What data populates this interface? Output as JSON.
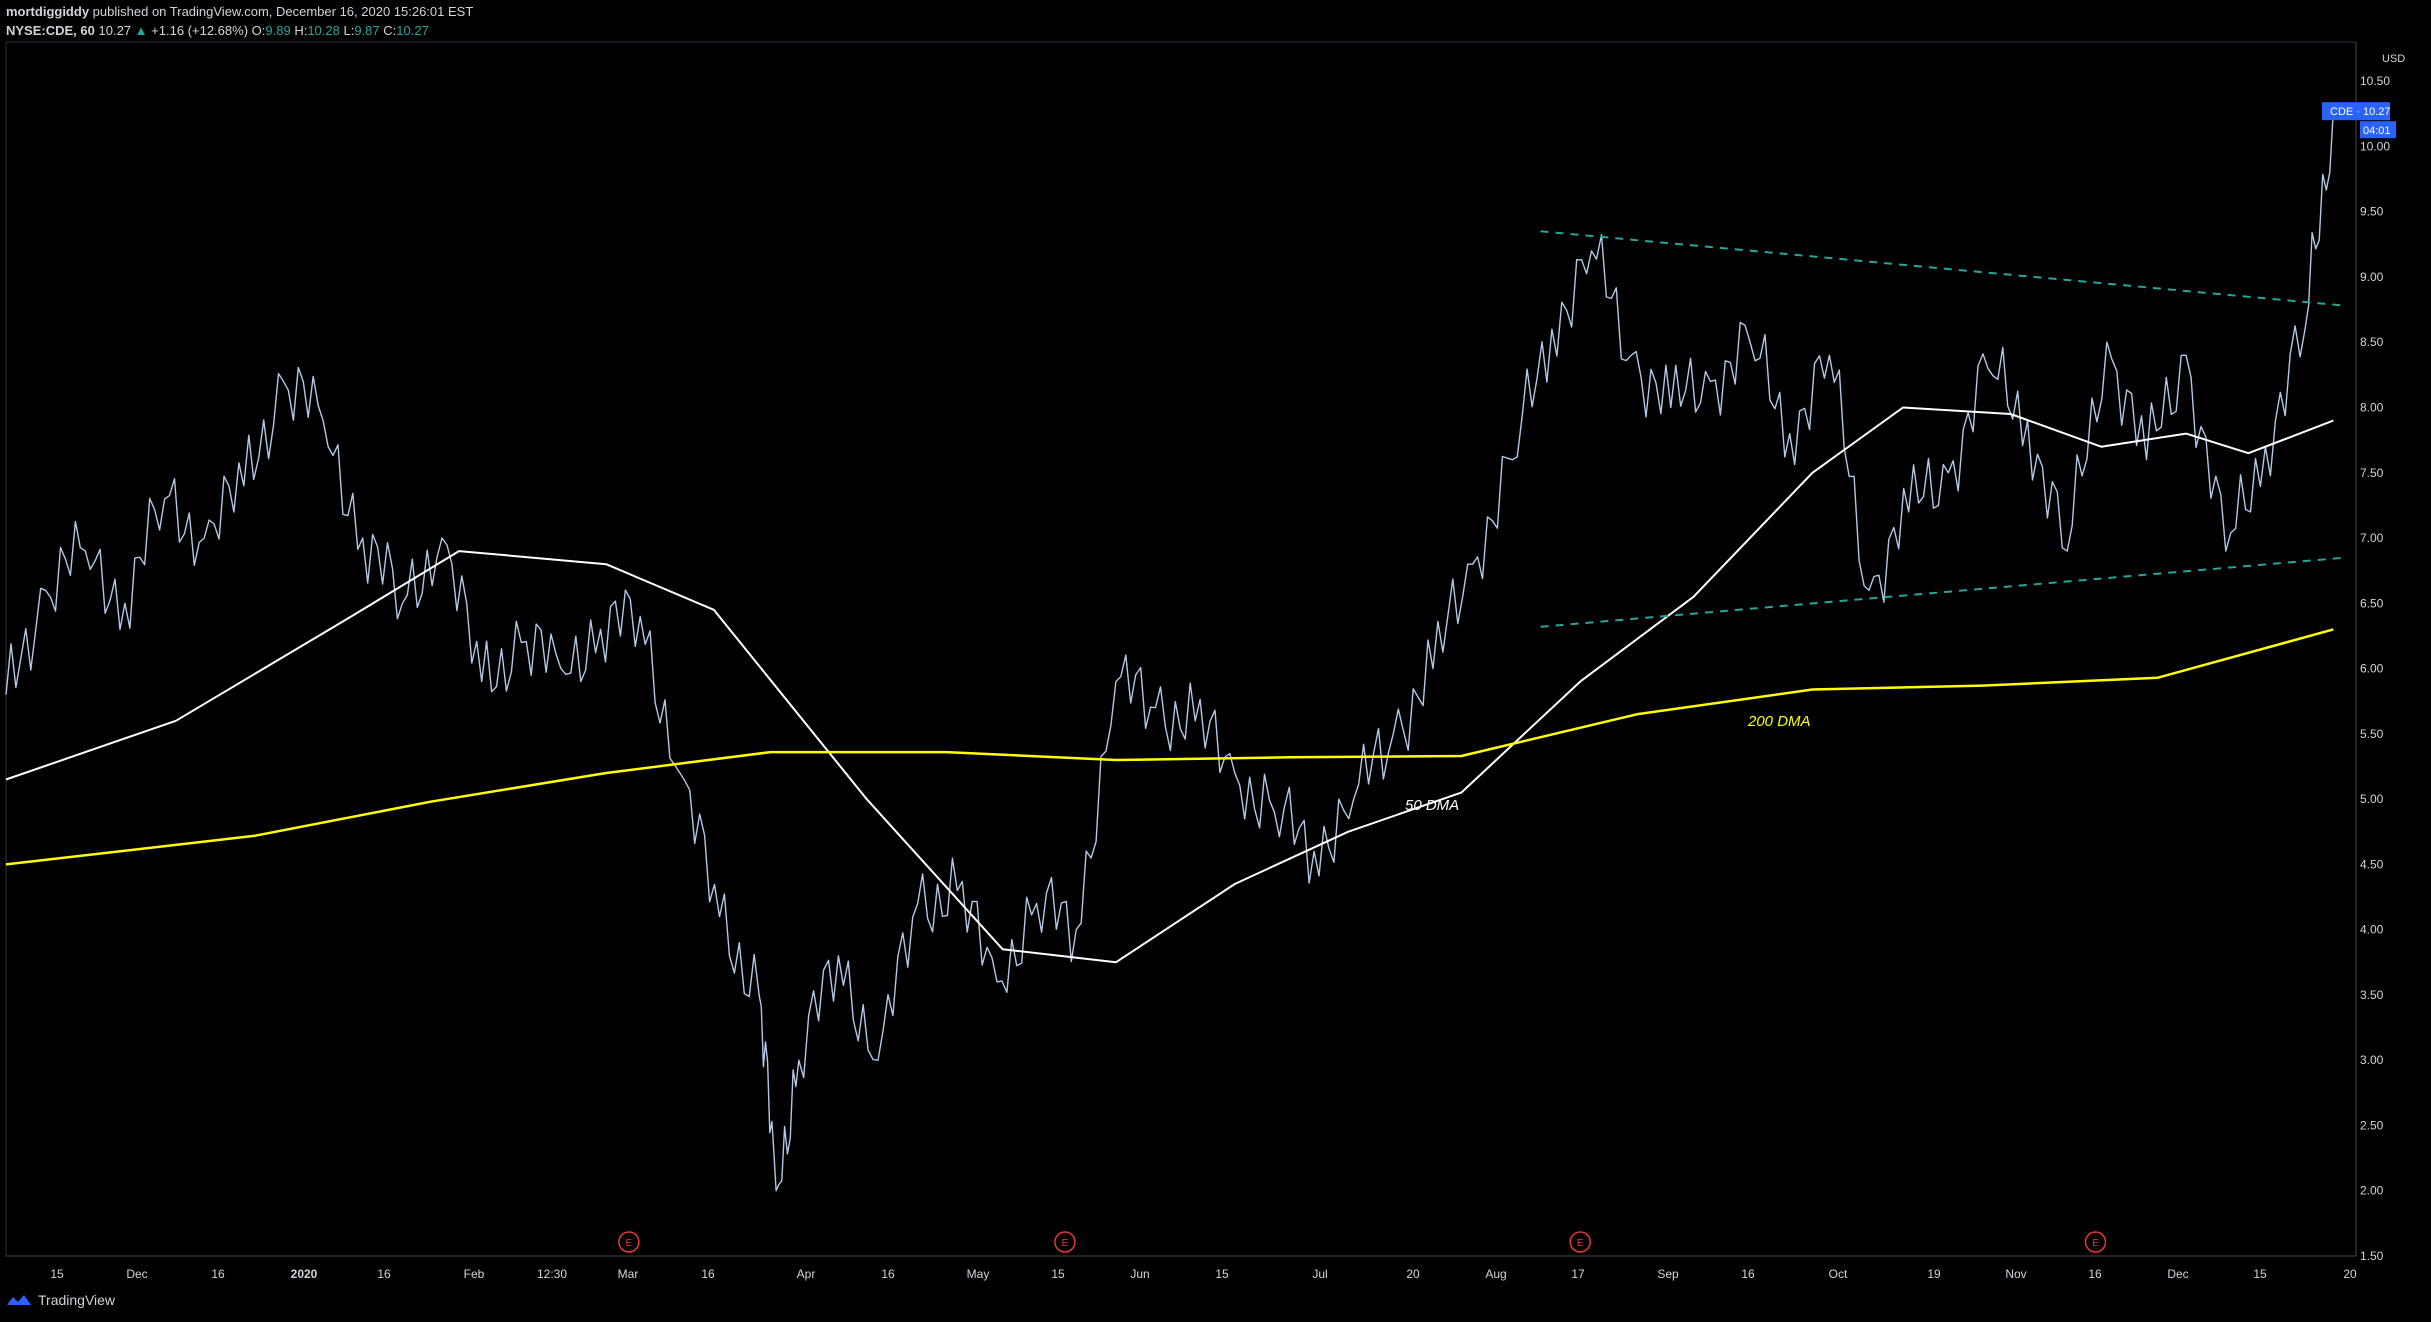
{
  "header": {
    "publisher": "mortdiggiddy",
    "published_text": "published on TradingView.com, December 16, 2020 15:26:01 EST",
    "symbol": "NYSE:CDE, 60",
    "last": "10.27",
    "change_arrow": "▲",
    "change": "+1.16 (+12.68%)",
    "o_label": "O:",
    "o": "9.89",
    "h_label": "H:",
    "h": "10.28",
    "l_label": "L:",
    "l": "9.87",
    "c_label": "C:",
    "c": "10.27"
  },
  "footer": {
    "brand": "TradingView"
  },
  "price_axis": {
    "currency": "USD",
    "ticks": [
      "10.50",
      "10.00",
      "9.50",
      "9.00",
      "8.50",
      "8.00",
      "7.50",
      "7.00",
      "6.50",
      "6.00",
      "5.50",
      "5.00",
      "4.50",
      "4.00",
      "3.50",
      "3.00",
      "2.50",
      "2.00",
      "1.50"
    ],
    "last_label": "CDE · 10.27",
    "countdown": "04:01"
  },
  "time_axis": {
    "ticks": [
      "15",
      "Dec",
      "16",
      "2020",
      "16",
      "Feb",
      "12:30",
      "Mar",
      "16",
      "Apr",
      "16",
      "May",
      "15",
      "Jun",
      "15",
      "Jul",
      "20",
      "Aug",
      "17",
      "Sep",
      "16",
      "Oct",
      "19",
      "Nov",
      "16",
      "Dec",
      "15",
      "20"
    ]
  },
  "earnings_marker": "E",
  "annotations": {
    "ma50": "50 DMA",
    "ma200": "200 DMA"
  },
  "colors": {
    "background": "#000000",
    "price": "#b2c8e6",
    "ma50": "#ffffff",
    "ma200": "#ffff00",
    "trendline": "#26a69a",
    "earnings": "#e53935",
    "label_bg": "#2962ff"
  },
  "chart_data": {
    "type": "line",
    "title": "NYSE:CDE, 60",
    "ylim": [
      1.5,
      10.8
    ],
    "ylabel": "USD",
    "x_start": "2019-11-01",
    "x_end": "2020-12-20",
    "series": [
      {
        "name": "CDE",
        "x": [
          "2019-11-01",
          "2019-11-08",
          "2019-11-15",
          "2019-11-22",
          "2019-11-29",
          "2019-12-06",
          "2019-12-13",
          "2019-12-20",
          "2019-12-27",
          "2020-01-03",
          "2020-01-10",
          "2020-01-17",
          "2020-01-24",
          "2020-01-31",
          "2020-02-07",
          "2020-02-14",
          "2020-02-21",
          "2020-02-28",
          "2020-03-06",
          "2020-03-13",
          "2020-03-16",
          "2020-03-20",
          "2020-03-27",
          "2020-04-03",
          "2020-04-10",
          "2020-04-17",
          "2020-04-24",
          "2020-05-01",
          "2020-05-08",
          "2020-05-15",
          "2020-05-22",
          "2020-05-29",
          "2020-06-05",
          "2020-06-12",
          "2020-06-19",
          "2020-06-26",
          "2020-07-03",
          "2020-07-10",
          "2020-07-17",
          "2020-07-24",
          "2020-07-31",
          "2020-08-07",
          "2020-08-14",
          "2020-08-21",
          "2020-08-28",
          "2020-09-04",
          "2020-09-11",
          "2020-09-18",
          "2020-09-25",
          "2020-10-02",
          "2020-10-09",
          "2020-10-16",
          "2020-10-23",
          "2020-10-30",
          "2020-11-06",
          "2020-11-13",
          "2020-11-20",
          "2020-11-27",
          "2020-12-04",
          "2020-12-11",
          "2020-12-16"
        ],
        "values": [
          5.8,
          6.6,
          6.9,
          6.5,
          7.3,
          7.0,
          7.4,
          8.2,
          7.9,
          7.0,
          6.5,
          7.0,
          5.9,
          6.2,
          6.0,
          6.3,
          6.4,
          5.2,
          4.1,
          3.5,
          2.0,
          3.0,
          3.8,
          3.0,
          4.2,
          4.3,
          3.6,
          4.2,
          4.0,
          5.9,
          5.7,
          5.6,
          5.2,
          4.9,
          4.6,
          5.0,
          5.5,
          6.0,
          6.8,
          7.6,
          8.6,
          9.2,
          8.4,
          8.0,
          8.2,
          8.5,
          7.8,
          8.4,
          6.6,
          7.2,
          7.5,
          8.3,
          7.9,
          6.9,
          8.5,
          7.6,
          8.4,
          6.9,
          7.7,
          8.6,
          10.27
        ]
      },
      {
        "name": "50 DMA",
        "x": [
          "2019-11-01",
          "2019-12-01",
          "2020-01-01",
          "2020-01-20",
          "2020-02-15",
          "2020-03-05",
          "2020-04-01",
          "2020-04-25",
          "2020-05-15",
          "2020-06-05",
          "2020-06-25",
          "2020-07-15",
          "2020-08-05",
          "2020-08-25",
          "2020-09-15",
          "2020-10-01",
          "2020-10-20",
          "2020-11-05",
          "2020-11-20",
          "2020-12-01",
          "2020-12-16"
        ],
        "values": [
          5.15,
          5.6,
          6.4,
          6.9,
          6.8,
          6.45,
          5.0,
          3.85,
          3.75,
          4.35,
          4.75,
          5.05,
          5.9,
          6.55,
          7.5,
          8.0,
          7.95,
          7.7,
          7.8,
          7.65,
          7.9
        ]
      },
      {
        "name": "200 DMA",
        "x": [
          "2019-11-01",
          "2019-12-15",
          "2020-01-15",
          "2020-02-15",
          "2020-03-15",
          "2020-04-15",
          "2020-05-15",
          "2020-06-15",
          "2020-07-15",
          "2020-08-15",
          "2020-09-15",
          "2020-10-15",
          "2020-11-15",
          "2020-12-16"
        ],
        "values": [
          4.5,
          4.72,
          4.98,
          5.2,
          5.36,
          5.36,
          5.3,
          5.32,
          5.33,
          5.65,
          5.84,
          5.87,
          5.93,
          6.3
        ]
      }
    ],
    "trendlines": [
      {
        "from": [
          "2020-07-29",
          9.35
        ],
        "to": [
          "2020-12-18",
          8.78
        ]
      },
      {
        "from": [
          "2020-07-29",
          6.32
        ],
        "to": [
          "2020-12-18",
          6.85
        ]
      }
    ],
    "earnings_dates": [
      "2020-02-19",
      "2020-05-06",
      "2020-08-05",
      "2020-11-04"
    ]
  }
}
